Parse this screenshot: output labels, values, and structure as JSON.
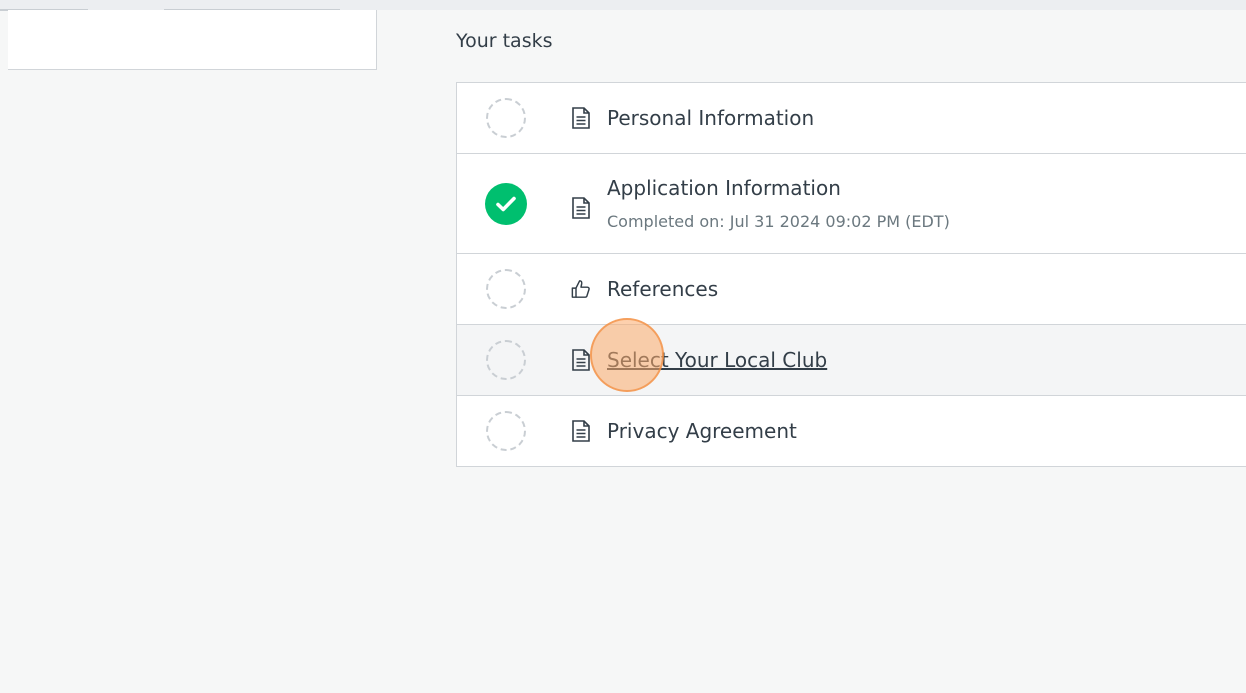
{
  "section": {
    "title": "Your tasks"
  },
  "tasks": [
    {
      "label": "Personal Information",
      "status": "pending",
      "icon": "document-icon"
    },
    {
      "label": "Application Information",
      "status": "completed",
      "completed_text": "Completed on: Jul 31 2024 09:02 PM (EDT)",
      "icon": "document-icon"
    },
    {
      "label": "References",
      "status": "pending",
      "icon": "thumbs-up-icon"
    },
    {
      "label": "Select Your Local Club",
      "status": "pending",
      "icon": "document-icon"
    },
    {
      "label": "Privacy Agreement",
      "status": "pending",
      "icon": "document-icon"
    }
  ],
  "colors": {
    "completed": "#00bf6f",
    "pending_border": "#c9ced3",
    "click_marker": "#f9a562"
  }
}
